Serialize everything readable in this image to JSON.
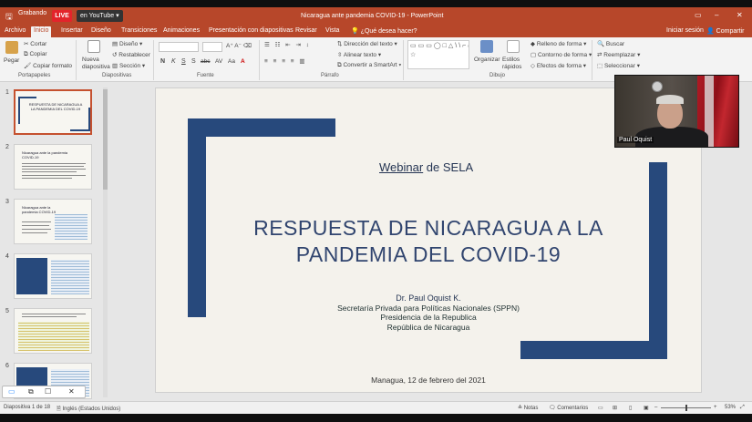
{
  "titlebar": {
    "recording": "Grabando",
    "live": "LIVE",
    "stream_target": "en YouTube",
    "window_title": "Nicaragua ante pandemia COVID-19 - PowerPoint"
  },
  "tabs": [
    "Archivo",
    "Inicio",
    "Insertar",
    "Diseño",
    "Transiciones",
    "Animaciones",
    "Presentación con diapositivas",
    "Revisar",
    "Vista",
    "¿Qué desea hacer?"
  ],
  "tabs_right": {
    "signin": "Iniciar sesión",
    "share": "Compartir"
  },
  "ribbon": {
    "clipboard": {
      "paste": "Pegar",
      "cut": "Cortar",
      "copy": "Copiar",
      "format_painter": "Copiar formato",
      "label": "Portapapeles"
    },
    "slides": {
      "new_slide": "Nueva diapositiva",
      "layout": "Diseño",
      "reset": "Restablecer",
      "section": "Sección",
      "label": "Diapositivas"
    },
    "font": {
      "bold": "N",
      "italic": "K",
      "underline": "S",
      "shadow": "S",
      "strike": "abc",
      "spacing": "AV",
      "case": "Aa",
      "label": "Fuente"
    },
    "paragraph": {
      "text_direction": "Dirección del texto",
      "align_text": "Alinear texto",
      "smartart": "Convertir a SmartArt",
      "label": "Párrafo"
    },
    "drawing": {
      "organize": "Organizar",
      "quick_styles": "Estilos rápidos",
      "shape_fill": "Relleno de forma",
      "shape_outline": "Contorno de forma",
      "shape_effects": "Efectos de forma",
      "label": "Dibujo",
      "shapes_preview": "▭▭▭◯□△\\\\⌐⌐▷{}☆"
    },
    "editing": {
      "find": "Buscar",
      "replace": "Reemplazar",
      "select": "Seleccionar"
    }
  },
  "thumbnails": [
    {
      "num": "1",
      "title": "RESPUESTA DE NICARAGUA A LA PANDEMIA DEL COVID-19"
    },
    {
      "num": "2",
      "title": "Nicaragua ante la pandemia COVID-19"
    },
    {
      "num": "3",
      "title": "Nicaragua ante la pandemia COVID-19"
    },
    {
      "num": "4",
      "title": ""
    },
    {
      "num": "5",
      "title": ""
    },
    {
      "num": "6",
      "title": ""
    }
  ],
  "slide": {
    "webinar_prefix": "Webinar",
    "webinar_suffix": " de SELA",
    "title_line1": "RESPUESTA DE NICARAGUA A LA",
    "title_line2": "PANDEMIA DEL COVID-19",
    "author": "Dr. Paul Oquist K.",
    "affiliation_1": "Secretaría Privada para Políticas Nacionales (SPPN)",
    "affiliation_2": "Presidencia de la Republica",
    "affiliation_3": "República de Nicaragua",
    "date": "Managua, 12 de febrero del 2021"
  },
  "video": {
    "participant": "Paul Oquist"
  },
  "statusbar": {
    "slide_count": "Diapositiva 1 de 18",
    "language": "Inglés (Estados Unidos)",
    "notes": "Notas",
    "comments": "Comentarios",
    "zoom": "53%"
  },
  "colors": {
    "accent": "#b7472a",
    "slide_blue": "#27497c",
    "title_blue": "#31456f"
  }
}
